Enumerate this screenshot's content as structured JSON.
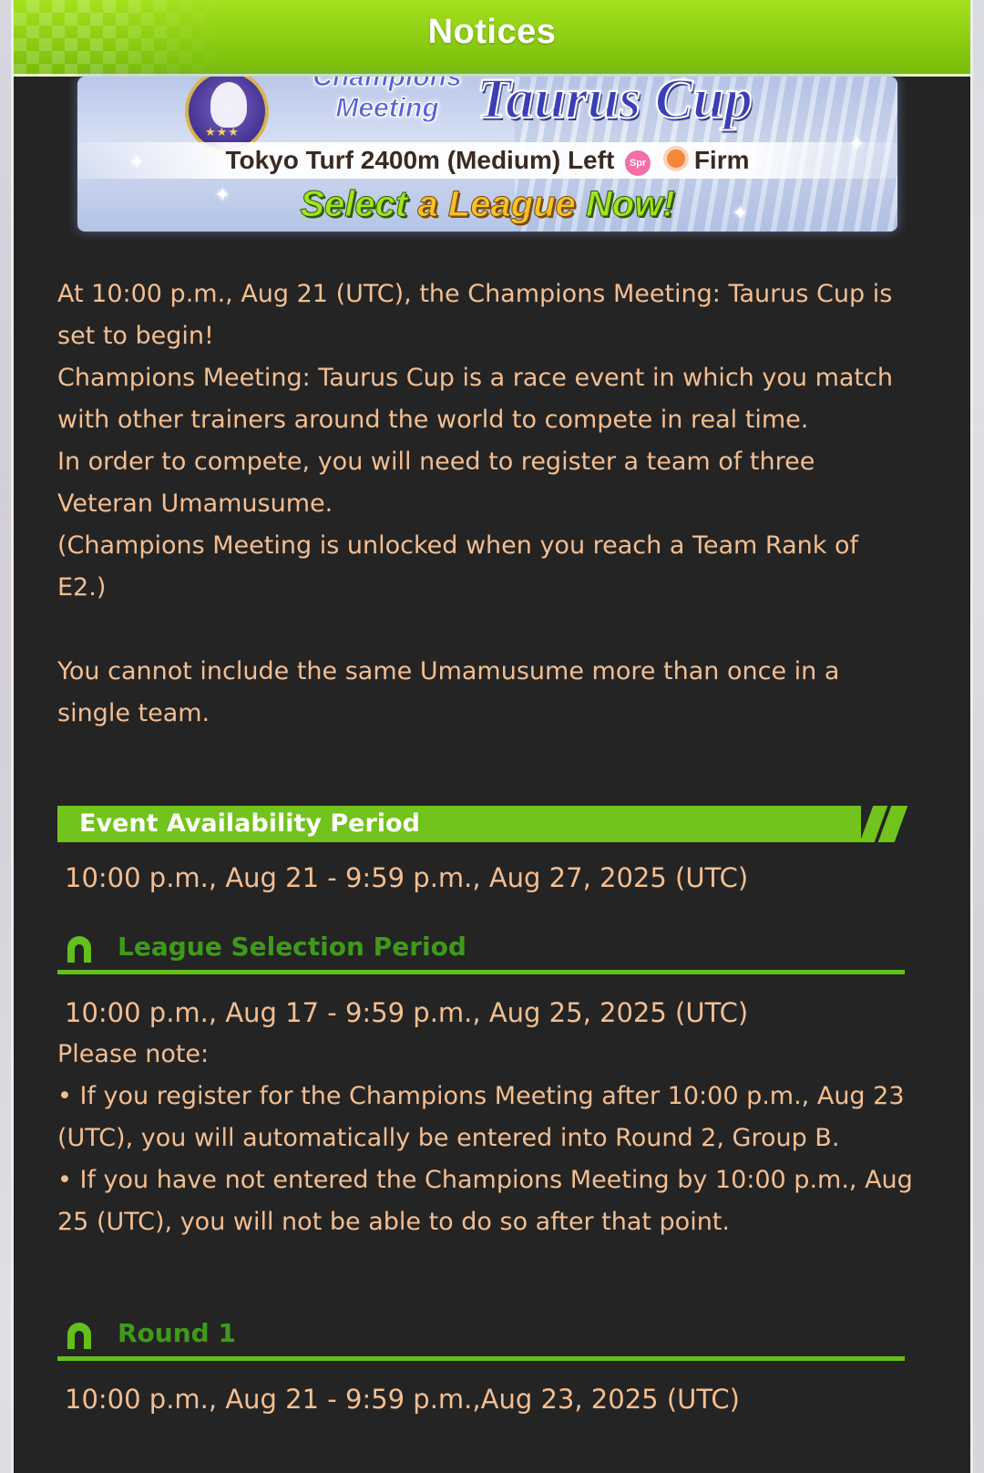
{
  "title": "Notices",
  "banner": {
    "meeting_text": "Champions Meeting",
    "cup_name": "Taurus Cup",
    "race_info": "Tokyo Turf 2400m (Medium) Left",
    "season_badge": "Spr",
    "ground": "Firm",
    "cta_a": "Select",
    "cta_b": "a League",
    "cta_c": "Now!"
  },
  "intro": {
    "p1": " At 10:00 p.m., Aug 21 (UTC), the Champions Meeting: Taurus Cup is set to begin!",
    "p2": " Champions Meeting: Taurus Cup is a race event in which you match with other trainers around the world to compete in real time.",
    "p3": " In order to compete, you will need to register a team of three Veteran Umamusume.",
    "p4": " (Champions Meeting is unlocked when you reach a Team Rank of E2.)",
    "p5": " You cannot include the same Umamusume more than once in a single team."
  },
  "event_period": {
    "heading": "Event Availability Period",
    "dates": "10:00 p.m., Aug 21 - 9:59 p.m., Aug 27, 2025 (UTC)"
  },
  "league_selection": {
    "heading": "League Selection Period",
    "dates": "10:00 p.m., Aug 17 - 9:59 p.m., Aug 25, 2025 (UTC)",
    "note_label": " Please note:",
    "note1": " • If you register for the Champions Meeting after 10:00 p.m., Aug 23 (UTC), you will automatically be entered into Round 2, Group B.",
    "note2": " • If you have not entered the Champions Meeting by 10:00 p.m., Aug 25 (UTC), you will not be able to do so after that point."
  },
  "round1": {
    "heading": "Round 1",
    "dates": "10:00 p.m., Aug 21 - 9:59 p.m.,Aug 23, 2025 (UTC)"
  },
  "colors": {
    "accent_green": "#72c31c",
    "heading_green": "#3f9a1a",
    "body_text": "#f3be91",
    "panel_bg": "#242424"
  }
}
